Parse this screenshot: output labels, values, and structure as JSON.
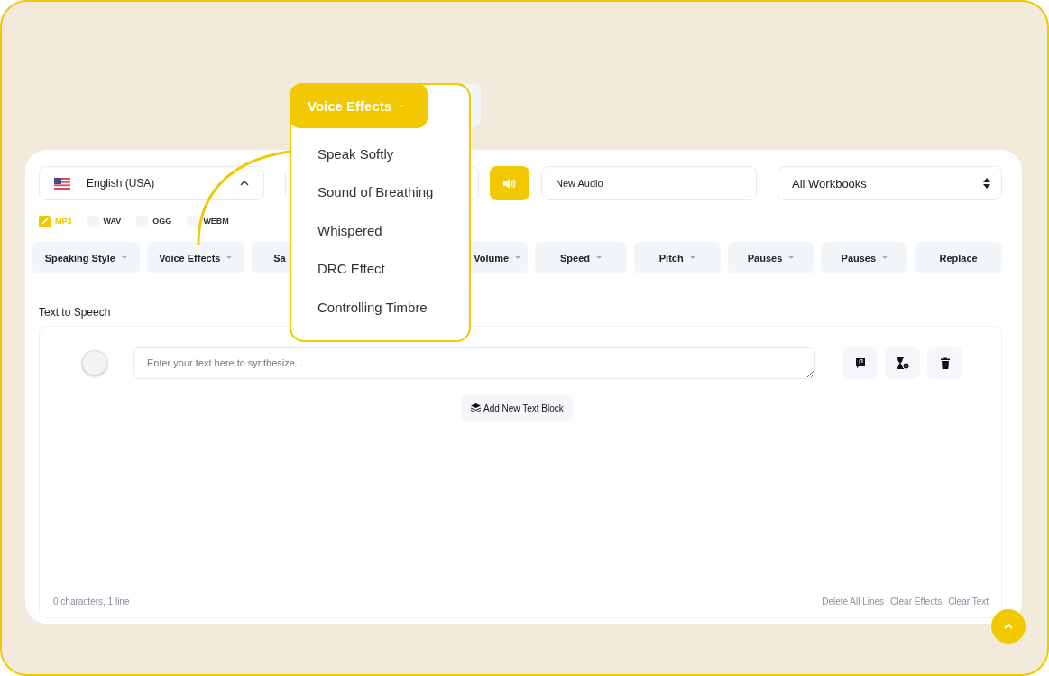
{
  "language_select": {
    "value": "English (USA)"
  },
  "title_field": {
    "value": "New Audio"
  },
  "workbook_select": {
    "value": "All Workbooks"
  },
  "formats": [
    {
      "label": "MP3",
      "checked": true
    },
    {
      "label": "WAV",
      "checked": false
    },
    {
      "label": "OGG",
      "checked": false
    },
    {
      "label": "WEBM",
      "checked": false
    }
  ],
  "toolbar": [
    {
      "label": "Speaking Style",
      "dropdown": true
    },
    {
      "label": "Voice Effects",
      "dropdown": true
    },
    {
      "label": "Sa"
    },
    {
      "label": "Volume",
      "dropdown": true
    },
    {
      "label": "Speed",
      "dropdown": true
    },
    {
      "label": "Pitch",
      "dropdown": true
    },
    {
      "label": "Pauses",
      "dropdown": true
    },
    {
      "label": "Pauses",
      "dropdown": true
    },
    {
      "label": "Replace",
      "dropdown": false
    }
  ],
  "section_label": "Text to Speech",
  "editor": {
    "placeholder": "Enter your text here to synthesize...",
    "add_block_button": "Add New Text Block",
    "status": "0 characters, 1 line",
    "actions": [
      "Delete All Lines",
      "Clear Effects",
      "Clear Text"
    ]
  },
  "popup": {
    "title": "Voice Effects",
    "items": [
      "Speak Softly",
      "Sound of Breathing",
      "Whispered",
      "DRC Effect",
      "Controlling Timbre"
    ]
  }
}
